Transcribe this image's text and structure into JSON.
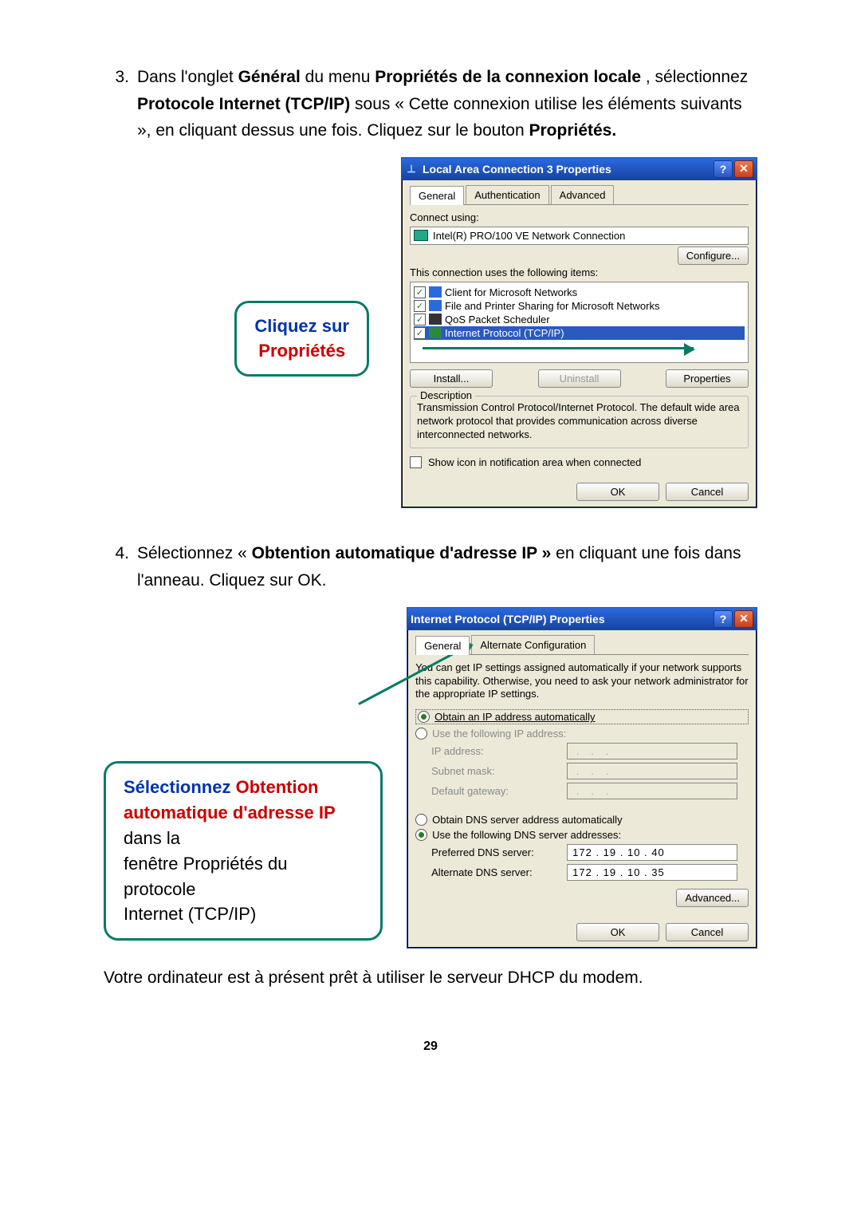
{
  "step3": {
    "num": "3.",
    "t1": "Dans l'onglet ",
    "b1": "Général",
    "t2": " du menu ",
    "b2": "Propriétés de la connexion locale",
    "t3": ", sélectionnez ",
    "b3": "Protocole Internet (TCP/IP)",
    "t4": " sous « Cette connexion utilise les éléments suivants », en cliquant dessus une fois. Cliquez sur le bouton ",
    "b4": "Propriétés.",
    "t5": ""
  },
  "callout1": {
    "line1": "Cliquez sur",
    "line2": "Propriétés"
  },
  "dlg1": {
    "title": "Local Area Connection 3 Properties",
    "tabs": [
      "General",
      "Authentication",
      "Advanced"
    ],
    "connect_using_label": "Connect using:",
    "adapter": "Intel(R) PRO/100 VE Network Connection",
    "configure_btn": "Configure...",
    "items_label": "This connection uses the following items:",
    "items": [
      "Client for Microsoft Networks",
      "File and Printer Sharing for Microsoft Networks",
      "QoS Packet Scheduler",
      "Internet Protocol (TCP/IP)"
    ],
    "install_btn": "Install...",
    "uninstall_btn": "Uninstall",
    "properties_btn": "Properties",
    "desc_legend": "Description",
    "desc_text": "Transmission Control Protocol/Internet Protocol. The default wide area network protocol that provides communication across diverse interconnected networks.",
    "show_icon": "Show icon in notification area when connected",
    "ok": "OK",
    "cancel": "Cancel"
  },
  "step4": {
    "num": "4.",
    "t1": "Sélectionnez « ",
    "b1": "Obtention automatique d'adresse IP »",
    "t2": " en cliquant une fois dans l'anneau. Cliquez sur OK."
  },
  "callout2": {
    "p1a": "Sélectionnez ",
    "p1b": "Obtention",
    "p2a": "automatique d'adresse IP",
    "p2b": " dans la",
    "p3": "fenêtre Propriétés du protocole",
    "p4": "Internet (TCP/IP)"
  },
  "dlg2": {
    "title": "Internet Protocol (TCP/IP) Properties",
    "tabs": [
      "General",
      "Alternate Configuration"
    ],
    "intro": "You can get IP settings assigned automatically if your network supports this capability. Otherwise, you need to ask your network administrator for the appropriate IP settings.",
    "opt_auto_ip": "Obtain an IP address automatically",
    "opt_static_ip": "Use the following IP address:",
    "ip_label": "IP address:",
    "subnet_label": "Subnet mask:",
    "gateway_label": "Default gateway:",
    "opt_auto_dns": "Obtain DNS server address automatically",
    "opt_static_dns": "Use the following DNS server addresses:",
    "pref_dns_label": "Preferred DNS server:",
    "alt_dns_label": "Alternate DNS server:",
    "pref_dns": "172 . 19 . 10 . 40",
    "alt_dns": "172 . 19 . 10 . 35",
    "advanced_btn": "Advanced...",
    "ok": "OK",
    "cancel": "Cancel"
  },
  "closing": "Votre ordinateur est à présent prêt à utiliser le serveur DHCP du modem.",
  "page_number": "29"
}
